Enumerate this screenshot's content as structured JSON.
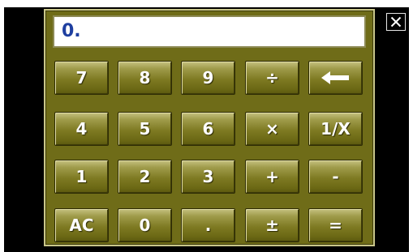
{
  "display": {
    "value": "0."
  },
  "close_icon": "close-icon",
  "keys": {
    "row1": [
      "7",
      "8",
      "9",
      "÷"
    ],
    "backspace_icon": "left-arrow-icon",
    "row2": [
      "4",
      "5",
      "6",
      "×",
      "1/X"
    ],
    "row3": [
      "1",
      "2",
      "3",
      "+",
      "-"
    ],
    "row4": [
      "AC",
      "0",
      ".",
      "±",
      "="
    ]
  },
  "colors": {
    "panel": "#6f6c18",
    "key_top": "#c6c281",
    "key_bottom": "#5b580f",
    "display_text": "#1f3fa0",
    "key_text": "#ffffff"
  }
}
